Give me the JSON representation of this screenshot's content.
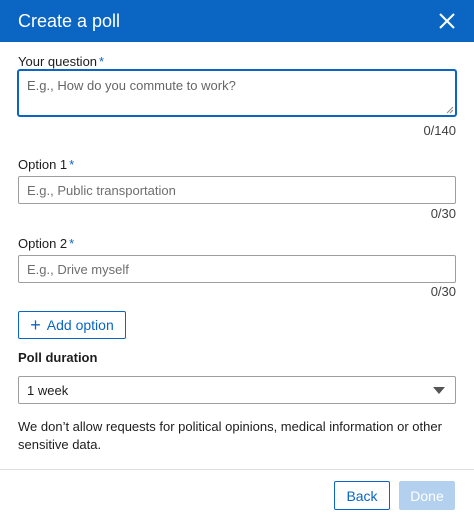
{
  "header": {
    "title": "Create a poll",
    "close_icon": "close-icon"
  },
  "question": {
    "label": "Your question",
    "required_mark": "*",
    "placeholder": "E.g., How do you commute to work?",
    "value": "",
    "counter": "0/140"
  },
  "options": [
    {
      "label": "Option 1",
      "required_mark": "*",
      "placeholder": "E.g., Public transportation",
      "value": "",
      "counter": "0/30"
    },
    {
      "label": "Option 2",
      "required_mark": "*",
      "placeholder": "E.g., Drive myself",
      "value": "",
      "counter": "0/30"
    }
  ],
  "add_option": {
    "label": "Add option",
    "icon": "plus-icon"
  },
  "duration": {
    "label": "Poll duration",
    "selected": "1 week",
    "icon": "chevron-down-icon"
  },
  "disclaimer": "We don’t allow requests for political opinions, medical information or other sensitive data.",
  "footer": {
    "back_label": "Back",
    "done_label": "Done",
    "done_enabled": false
  },
  "colors": {
    "brand": "#0a66c2",
    "done_disabled_bg": "#b3d1ee"
  }
}
